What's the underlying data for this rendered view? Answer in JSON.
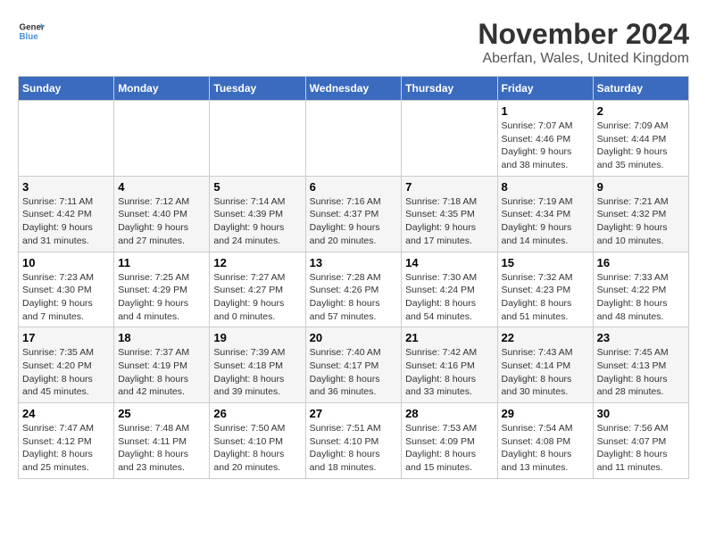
{
  "header": {
    "logo_general": "General",
    "logo_blue": "Blue",
    "month": "November 2024",
    "location": "Aberfan, Wales, United Kingdom"
  },
  "weekdays": [
    "Sunday",
    "Monday",
    "Tuesday",
    "Wednesday",
    "Thursday",
    "Friday",
    "Saturday"
  ],
  "weeks": [
    [
      {
        "day": "",
        "info": ""
      },
      {
        "day": "",
        "info": ""
      },
      {
        "day": "",
        "info": ""
      },
      {
        "day": "",
        "info": ""
      },
      {
        "day": "",
        "info": ""
      },
      {
        "day": "1",
        "info": "Sunrise: 7:07 AM\nSunset: 4:46 PM\nDaylight: 9 hours and 38 minutes."
      },
      {
        "day": "2",
        "info": "Sunrise: 7:09 AM\nSunset: 4:44 PM\nDaylight: 9 hours and 35 minutes."
      }
    ],
    [
      {
        "day": "3",
        "info": "Sunrise: 7:11 AM\nSunset: 4:42 PM\nDaylight: 9 hours and 31 minutes."
      },
      {
        "day": "4",
        "info": "Sunrise: 7:12 AM\nSunset: 4:40 PM\nDaylight: 9 hours and 27 minutes."
      },
      {
        "day": "5",
        "info": "Sunrise: 7:14 AM\nSunset: 4:39 PM\nDaylight: 9 hours and 24 minutes."
      },
      {
        "day": "6",
        "info": "Sunrise: 7:16 AM\nSunset: 4:37 PM\nDaylight: 9 hours and 20 minutes."
      },
      {
        "day": "7",
        "info": "Sunrise: 7:18 AM\nSunset: 4:35 PM\nDaylight: 9 hours and 17 minutes."
      },
      {
        "day": "8",
        "info": "Sunrise: 7:19 AM\nSunset: 4:34 PM\nDaylight: 9 hours and 14 minutes."
      },
      {
        "day": "9",
        "info": "Sunrise: 7:21 AM\nSunset: 4:32 PM\nDaylight: 9 hours and 10 minutes."
      }
    ],
    [
      {
        "day": "10",
        "info": "Sunrise: 7:23 AM\nSunset: 4:30 PM\nDaylight: 9 hours and 7 minutes."
      },
      {
        "day": "11",
        "info": "Sunrise: 7:25 AM\nSunset: 4:29 PM\nDaylight: 9 hours and 4 minutes."
      },
      {
        "day": "12",
        "info": "Sunrise: 7:27 AM\nSunset: 4:27 PM\nDaylight: 9 hours and 0 minutes."
      },
      {
        "day": "13",
        "info": "Sunrise: 7:28 AM\nSunset: 4:26 PM\nDaylight: 8 hours and 57 minutes."
      },
      {
        "day": "14",
        "info": "Sunrise: 7:30 AM\nSunset: 4:24 PM\nDaylight: 8 hours and 54 minutes."
      },
      {
        "day": "15",
        "info": "Sunrise: 7:32 AM\nSunset: 4:23 PM\nDaylight: 8 hours and 51 minutes."
      },
      {
        "day": "16",
        "info": "Sunrise: 7:33 AM\nSunset: 4:22 PM\nDaylight: 8 hours and 48 minutes."
      }
    ],
    [
      {
        "day": "17",
        "info": "Sunrise: 7:35 AM\nSunset: 4:20 PM\nDaylight: 8 hours and 45 minutes."
      },
      {
        "day": "18",
        "info": "Sunrise: 7:37 AM\nSunset: 4:19 PM\nDaylight: 8 hours and 42 minutes."
      },
      {
        "day": "19",
        "info": "Sunrise: 7:39 AM\nSunset: 4:18 PM\nDaylight: 8 hours and 39 minutes."
      },
      {
        "day": "20",
        "info": "Sunrise: 7:40 AM\nSunset: 4:17 PM\nDaylight: 8 hours and 36 minutes."
      },
      {
        "day": "21",
        "info": "Sunrise: 7:42 AM\nSunset: 4:16 PM\nDaylight: 8 hours and 33 minutes."
      },
      {
        "day": "22",
        "info": "Sunrise: 7:43 AM\nSunset: 4:14 PM\nDaylight: 8 hours and 30 minutes."
      },
      {
        "day": "23",
        "info": "Sunrise: 7:45 AM\nSunset: 4:13 PM\nDaylight: 8 hours and 28 minutes."
      }
    ],
    [
      {
        "day": "24",
        "info": "Sunrise: 7:47 AM\nSunset: 4:12 PM\nDaylight: 8 hours and 25 minutes."
      },
      {
        "day": "25",
        "info": "Sunrise: 7:48 AM\nSunset: 4:11 PM\nDaylight: 8 hours and 23 minutes."
      },
      {
        "day": "26",
        "info": "Sunrise: 7:50 AM\nSunset: 4:10 PM\nDaylight: 8 hours and 20 minutes."
      },
      {
        "day": "27",
        "info": "Sunrise: 7:51 AM\nSunset: 4:10 PM\nDaylight: 8 hours and 18 minutes."
      },
      {
        "day": "28",
        "info": "Sunrise: 7:53 AM\nSunset: 4:09 PM\nDaylight: 8 hours and 15 minutes."
      },
      {
        "day": "29",
        "info": "Sunrise: 7:54 AM\nSunset: 4:08 PM\nDaylight: 8 hours and 13 minutes."
      },
      {
        "day": "30",
        "info": "Sunrise: 7:56 AM\nSunset: 4:07 PM\nDaylight: 8 hours and 11 minutes."
      }
    ]
  ]
}
